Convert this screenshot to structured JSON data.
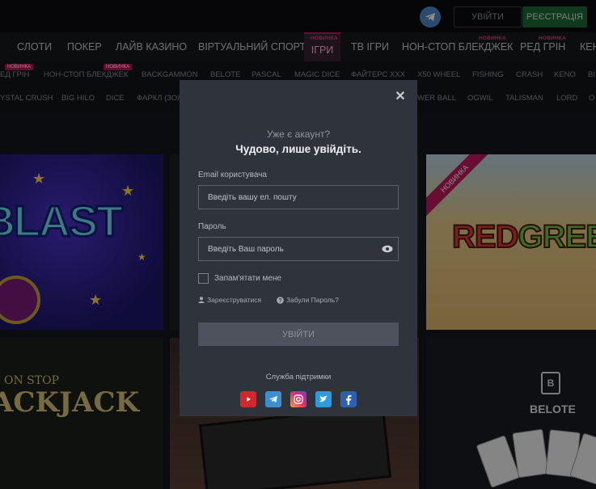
{
  "header": {
    "logo_text": "",
    "login_label": "УВІЙТИ",
    "register_label": "РЕЄСТРАЦІЯ"
  },
  "mainnav": {
    "items": [
      {
        "label": "СЛОТИ"
      },
      {
        "label": "ПОКЕР"
      },
      {
        "label": "ЛАЙВ КАЗИНО"
      },
      {
        "label": "ВІРТУАЛЬНИЙ СПОРТ"
      },
      {
        "label": "ІГРИ",
        "badge": "НОВИНКА",
        "active": true
      },
      {
        "label": "ТВ ІГРИ"
      },
      {
        "label": "НОН-СТОП БЛЕКДЖЕК",
        "badge": "НОВИНКА"
      },
      {
        "label": "РЕД ГРІН",
        "badge": "НОВИНКА"
      },
      {
        "label": "КЕН"
      }
    ]
  },
  "subnav": {
    "row1": [
      "ЕД ГРІН",
      "НОН-СТОП БЛЕКДЖЕК",
      "BACKGAMMON",
      "BELOTE",
      "PASCAL",
      "MAGIC DICE",
      "ФАЙТЕРС ХХХ",
      "X50 WHEEL",
      "FISHING",
      "CRASH",
      "KENO",
      "BI"
    ],
    "row1_badges": [
      "НОВИНКА",
      "НОВИНКА"
    ],
    "row2": [
      "YSTAL CRUSH",
      "BIG HILO",
      "DICE",
      "ФАРКЛ (ЗОЛ",
      "WER BALL",
      "OGWIL",
      "TALISMAN",
      "LORD",
      "O"
    ]
  },
  "tiles": {
    "blast_title": "BLAST",
    "redgreen_ribbon": "НОВИНКА",
    "redgreen_red": "RED",
    "redgreen_green": "GREEN",
    "bj_small": "ON        STOP",
    "bj_title": "ACKJACK",
    "belote_title": "BELOTE"
  },
  "modal": {
    "subtitle": "Уже є акаунт?",
    "title": "Чудово, лише увійдіть.",
    "email_label": "Email користувача",
    "email_placeholder": "Введіть вашу ел. пошту",
    "password_label": "Пароль",
    "password_placeholder": "Введіть Ваш пароль",
    "remember_label": "Запам'ятати мене",
    "register_link": "Зареєструватися",
    "forgot_link": "Забули Пароль?",
    "submit_label": "УВІЙТИ",
    "support_label": "Служба підтримки"
  },
  "colors": {
    "accent": "#c2185b",
    "register_green": "#1d6b37",
    "modal_bg": "#2f333b"
  }
}
